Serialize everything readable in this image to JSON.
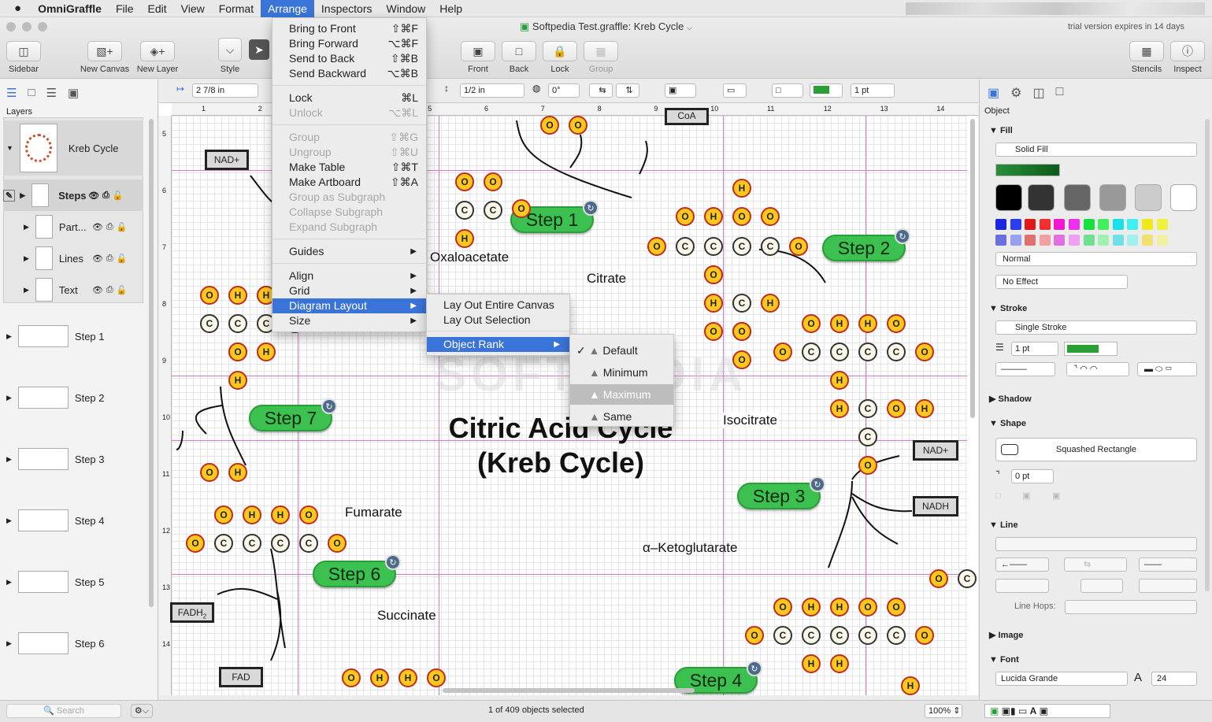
{
  "menubar": {
    "app": "OmniGraffle",
    "items": [
      "File",
      "Edit",
      "View",
      "Format",
      "Arrange",
      "Inspectors",
      "Window",
      "Help"
    ]
  },
  "window": {
    "title": "Softpedia Test.graffle: Kreb Cycle",
    "trial": "trial version expires in 14 days"
  },
  "toolbar": {
    "sidebar": "Sidebar",
    "new_canvas": "New Canvas",
    "new_layer": "New Layer",
    "style": "Style",
    "front": "Front",
    "back": "Back",
    "lock": "Lock",
    "group": "Group",
    "stencils": "Stencils",
    "inspect": "Inspect"
  },
  "formatbar": {
    "x": "2 7/8 in",
    "h": "1/2 in",
    "angle": "0°",
    "stroke": "1 pt"
  },
  "sidebar": {
    "layers_label": "Layers",
    "canvas_name": "Kreb Cycle",
    "layers": [
      "Steps",
      "Part...",
      "Lines",
      "Text"
    ],
    "canvases": [
      "Step 1",
      "Step 2",
      "Step 3",
      "Step 4",
      "Step 5",
      "Step 6"
    ],
    "search_placeholder": "Search"
  },
  "ruler": {
    "h": [
      "1",
      "2",
      "3",
      "4",
      "5",
      "6",
      "7",
      "8",
      "9",
      "10",
      "11",
      "12",
      "13",
      "14"
    ],
    "v": [
      "5",
      "6",
      "7",
      "8",
      "9",
      "10",
      "11",
      "12",
      "13",
      "14"
    ]
  },
  "canvas": {
    "title_line1": "Citric Acid Cycle",
    "title_line2": "(Kreb Cycle)",
    "steps": [
      "Step 1",
      "Step 2",
      "Step 3",
      "Step 4",
      "Step 6",
      "Step 7"
    ],
    "molecules": [
      "Oxaloacetate",
      "Citrate",
      "Isocitrate",
      "Fumarate",
      "α–Ketoglutarate",
      "Succinate"
    ],
    "boxes": [
      "NAD+",
      "NAD+",
      "NADH",
      "FADH",
      "FAD",
      "CoA"
    ],
    "box_subscript": "2",
    "atoms": {
      "o": "O",
      "c": "C",
      "h": "H"
    }
  },
  "arrange_menu": [
    {
      "label": "Bring to Front",
      "shortcut": "⇧⌘F"
    },
    {
      "label": "Bring Forward",
      "shortcut": "⌥⌘F"
    },
    {
      "label": "Send to Back",
      "shortcut": "⇧⌘B"
    },
    {
      "label": "Send Backward",
      "shortcut": "⌥⌘B"
    },
    {
      "label": "Lock",
      "shortcut": "⌘L"
    },
    {
      "label": "Unlock",
      "shortcut": "⌥⌘L"
    },
    {
      "label": "Group",
      "shortcut": "⇧⌘G"
    },
    {
      "label": "Ungroup",
      "shortcut": "⇧⌘U"
    },
    {
      "label": "Make Table",
      "shortcut": "⇧⌘T"
    },
    {
      "label": "Make Artboard",
      "shortcut": "⇧⌘A"
    },
    {
      "label": "Group as Subgraph",
      "shortcut": ""
    },
    {
      "label": "Collapse Subgraph",
      "shortcut": ""
    },
    {
      "label": "Expand Subgraph",
      "shortcut": ""
    },
    {
      "label": "Guides",
      "shortcut": ""
    },
    {
      "label": "Align",
      "shortcut": ""
    },
    {
      "label": "Grid",
      "shortcut": ""
    },
    {
      "label": "Diagram Layout",
      "shortcut": ""
    },
    {
      "label": "Size",
      "shortcut": ""
    }
  ],
  "layout_menu": [
    "Lay Out Entire Canvas",
    "Lay Out Selection",
    "Object Rank"
  ],
  "rank_menu": [
    "Default",
    "Minimum",
    "Maximum",
    "Same"
  ],
  "inspector": {
    "object": "Object",
    "fill": "Fill",
    "fill_type": "Solid Fill",
    "blend": "Normal",
    "effect": "No Effect",
    "stroke": "Stroke",
    "stroke_type": "Single Stroke",
    "stroke_width": "1 pt",
    "shadow": "Shadow",
    "shape": "Shape",
    "shape_name": "Squashed Rectangle",
    "corner": "0 pt",
    "line": "Line",
    "line_hops": "Line Hops:",
    "image": "Image",
    "font": "Font",
    "font_name": "Lucida Grande",
    "font_size": "24"
  },
  "status": {
    "selection": "1 of 409 objects selected",
    "zoom": "100%"
  },
  "colors": {
    "accent": "#3b74d8",
    "step_green": "#3cc150",
    "oxygen": "#ffc81e",
    "guide": "#d27ad2"
  }
}
